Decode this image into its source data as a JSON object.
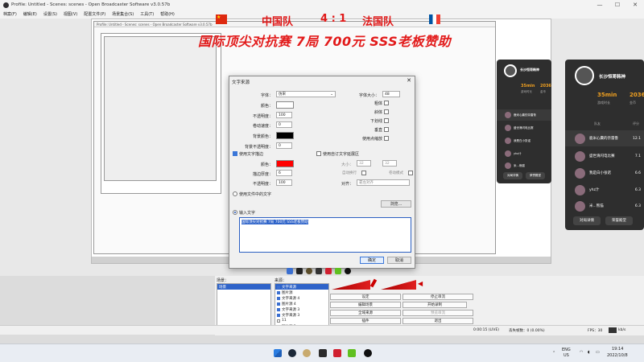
{
  "window": {
    "title": "Profile: Untitled - Scenes: scenes - Open Broadcaster Software v3.0.57b",
    "menu": [
      "档案(F)",
      "编辑(E)",
      "设置(S)",
      "视图(V)",
      "配置文件(P)",
      "场景集合(S)",
      "工具(T)",
      "帮助(H)"
    ]
  },
  "overlay": {
    "team_left": "中国队",
    "score": "4 : 1",
    "team_right": "法国队",
    "banner": "国际顶尖对抗赛 7局 700元 SSS老板赞助"
  },
  "scoreboard_small": {
    "player": "长沙恒哥韩神",
    "time": "35min",
    "score": "2036",
    "time_label": "游戏时长",
    "score_label": "金币",
    "rows": [
      "鹿米心麋的奈雷鲁",
      "盛世滑闪电比赛",
      "我是白小张诺",
      "yhz汁",
      "米...熊猫"
    ],
    "buttons": [
      "对局详情",
      "荣誉殿堂"
    ]
  },
  "scoreboard_large": {
    "player": "长沙恒哥韩神",
    "time": "35min",
    "score": "2036",
    "time_label": "游戏时长",
    "score_label": "金币",
    "col_left": "队友",
    "col_right": "评分",
    "rows": [
      {
        "name": "鹿米心麋的奈雷鲁",
        "val": "12.1"
      },
      {
        "name": "盛世滑闪电比赛",
        "val": "7.1"
      },
      {
        "name": "我是白小张诺",
        "val": "6.6"
      },
      {
        "name": "yhz汁",
        "val": "6.3"
      },
      {
        "name": "米...熊猫",
        "val": "6.3"
      }
    ],
    "buttons": [
      "对局详情",
      "荣誉殿堂"
    ]
  },
  "dialog": {
    "title": "文字来源",
    "font_label": "字体：",
    "font_value": "仿宋",
    "size_label": "字体大小：",
    "size_value": "48",
    "color_label": "颜色：",
    "opacity_label": "不透明度：",
    "opacity_value": "100",
    "scroll_label": "卷动速度：",
    "scroll_value": "0",
    "bg_color_label": "背景颜色：",
    "bg_opacity_label": "背景不透明度：",
    "bg_opacity_value": "0",
    "bold": "粗体",
    "italic": "斜体",
    "underline": "下划线",
    "vertical": "垂直",
    "outline": "使用点缩放",
    "use_outline": "使用文字描边",
    "outline_color_label": "颜色：",
    "outline_size_label": "描边厚度：",
    "outline_size_value": "6",
    "outline_opacity_label": "不透明度：",
    "outline_opacity_value": "100",
    "use_custom_extents": "使用自订文字延展区",
    "extent_size_label": "大小：",
    "extent_w": "32",
    "extent_h": "32",
    "wrap": "自动换行",
    "scroll_mode": "卷动模式",
    "align_label": "对齐：",
    "align_value": "靠左对齐",
    "use_file": "使用文件中的文字",
    "browse": "浏览...",
    "use_input": "输入文字",
    "text_value": "国际顶尖对抗赛 7局 700元 SSS老板赞助",
    "ok": "确定",
    "cancel": "取消"
  },
  "docks": {
    "scenes_header": "场景：",
    "scenes": [
      "场景"
    ],
    "sources_header": "来源：",
    "sources": [
      "文字来源",
      "图片源",
      "文字来源 4",
      "图片源 4",
      "文字来源 3",
      "文字来源 3",
      "11",
      "图片源 2"
    ],
    "controls": [
      "设定",
      "停止串流",
      "编辑场景",
      "开始录制",
      "全域来源",
      "预览串流",
      "插件",
      "退出"
    ]
  },
  "status": {
    "time": "0:00:15 (LIVE)",
    "dropped": "丢失帧数：0 (0.00%)",
    "fps": "FPS：30",
    "bitrate": "kb/s"
  },
  "tray": {
    "lang": "ENG",
    "region": "US",
    "time": "19:14",
    "date": "2022/10/8"
  }
}
